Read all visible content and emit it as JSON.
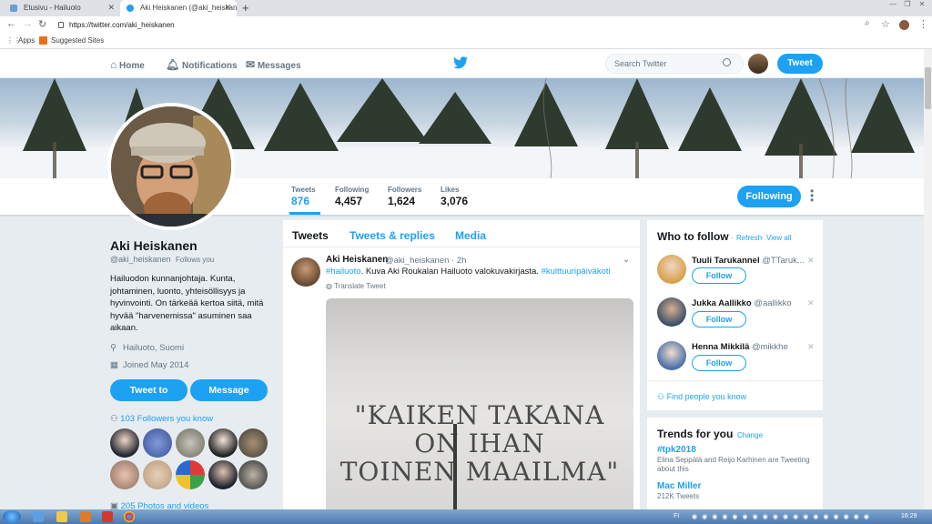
{
  "browser": {
    "tabs": [
      {
        "title": "Etusivu - Hailuoto",
        "active": false
      },
      {
        "title": "Aki Heiskanen (@aki_heiskanen) | Tw",
        "active": true
      }
    ],
    "url": "https://twitter.com/aki_heiskanen",
    "bookmarks": {
      "apps": "Apps",
      "suggested": "Suggested Sites"
    }
  },
  "nav": {
    "home": "Home",
    "notifications": "Notifications",
    "messages": "Messages",
    "search_placeholder": "Search Twitter",
    "tweet_button": "Tweet"
  },
  "stats": [
    {
      "label": "Tweets",
      "value": "876",
      "active": true
    },
    {
      "label": "Following",
      "value": "4,457"
    },
    {
      "label": "Followers",
      "value": "1,624"
    },
    {
      "label": "Likes",
      "value": "3,076"
    }
  ],
  "following_button": "Following",
  "profile": {
    "name": "Aki Heiskanen",
    "handle": "@aki_heiskanen",
    "follows_you": "Follows you",
    "bio": "Hailuodon kunnanjohtaja. Kunta, johtaminen, luonto, yhteisöllisyys ja hyvinvointi. On tärkeää kertoa siitä, mitä hyvää \"harvenemissa\" asuminen saa aikaan.",
    "location": "Hailuoto, Suomi",
    "joined": "Joined May 2014",
    "tweet_to": "Tweet to",
    "message": "Message",
    "followers_you_know": "103 Followers you know",
    "photos_videos": "205 Photos and videos"
  },
  "timeline": {
    "tabs": [
      "Tweets",
      "Tweets & replies",
      "Media"
    ],
    "tweet": {
      "author": "Aki Heiskanen",
      "handle": "@aki_heiskanen · 2h",
      "hashtag1": "#hailuoto",
      "text": ". Kuva Aki Roukalan Hailuoto valokuvakirjasta. ",
      "hashtag2": "#kulttuuripäiväkoti",
      "translate": "Translate Tweet",
      "image_text": [
        "\"KAIKEN TAKANA",
        "ON IHAN",
        "TOINEN MAAILMA\""
      ]
    }
  },
  "who_to_follow": {
    "title": "Who to follow",
    "refresh": "Refresh",
    "view_all": "View all",
    "dot": "·",
    "people": [
      {
        "name": "Tuuli Tarukannel",
        "handle": "@TTaruk...",
        "button": "Follow"
      },
      {
        "name": "Jukka Aallikko",
        "handle": "@aallikko",
        "button": "Follow"
      },
      {
        "name": "Henna Mikkilä",
        "handle": "@mikkhe",
        "button": "Follow"
      }
    ],
    "find_people": "Find people you know"
  },
  "trends": {
    "title": "Trends for you",
    "change": "Change",
    "dot": "·",
    "items": [
      {
        "name": "#tpk2018",
        "desc": "Elina Seppälä and Reijo Karhinen are Tweeting about this"
      },
      {
        "name": "Mac Miller",
        "desc": "212K Tweets"
      }
    ]
  },
  "taskbar": {
    "clock": "16:29",
    "lang": "FI"
  },
  "colors": {
    "accent": "#1da1f2",
    "background": "#e6ecf0"
  }
}
